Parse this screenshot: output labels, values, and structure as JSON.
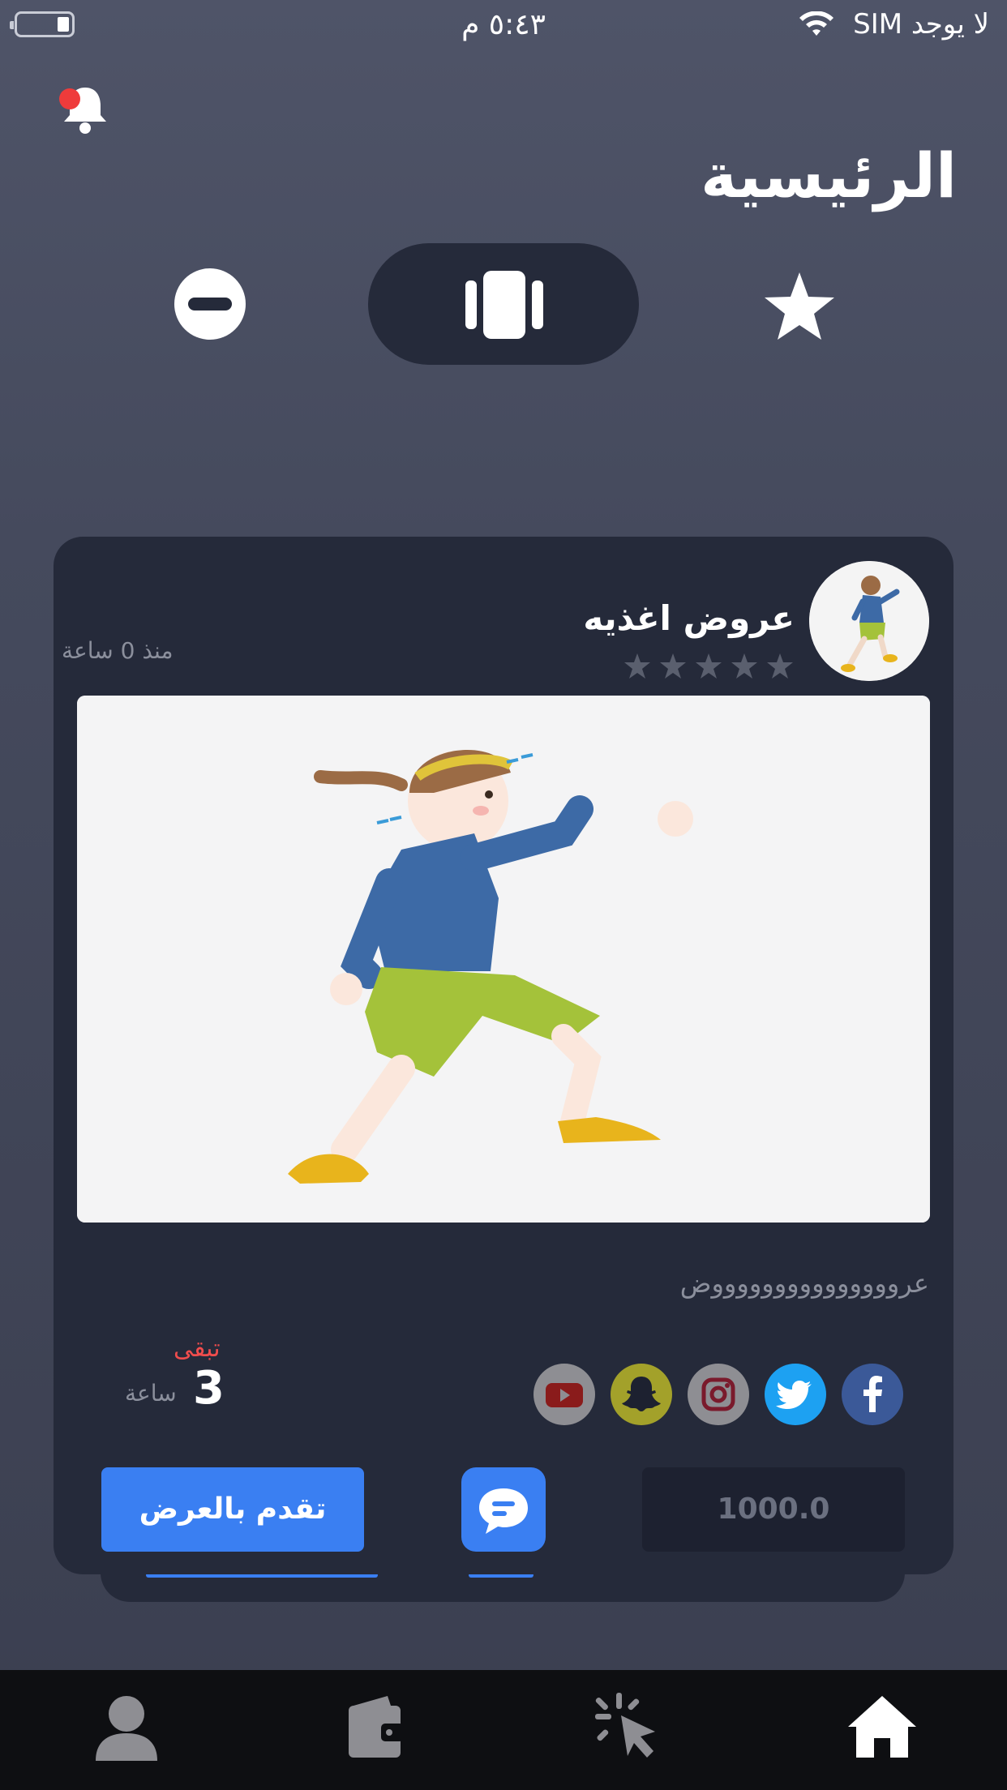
{
  "status_bar": {
    "time": "٥:٤٣ م",
    "carrier": "لا يوجد SIM",
    "battery_level": 0.2
  },
  "header": {
    "title": "الرئيسية"
  },
  "view_switcher": {
    "options": [
      "star-icon",
      "cards-icon",
      "minus-icon"
    ],
    "selected": "cards-icon"
  },
  "offer_card": {
    "title": "عروض اغذيه",
    "rating": 0,
    "max_rating": 5,
    "time_ago": "منذ 0 ساعة",
    "description": "عروووووووووووووووض",
    "remaining_label": "تبقى",
    "remaining_value": "3",
    "remaining_unit": "ساعة",
    "social": [
      {
        "name": "facebook",
        "color": "#3b5998"
      },
      {
        "name": "twitter",
        "color": "#1da1f2"
      },
      {
        "name": "instagram",
        "color": "#8e8e93"
      },
      {
        "name": "snapchat",
        "color": "#a3a12a"
      },
      {
        "name": "youtube",
        "color": "#8e8e93"
      }
    ],
    "price": "1000.0",
    "apply_label": "تقدم بالعرض"
  },
  "tab_bar": {
    "items": [
      "home-icon",
      "cursor-click-icon",
      "wallet-icon",
      "profile-icon"
    ],
    "selected": "home-icon"
  },
  "colors": {
    "accent": "#3a7ff2",
    "card_bg": "#252a3a",
    "alert_red": "#f04d4d"
  }
}
